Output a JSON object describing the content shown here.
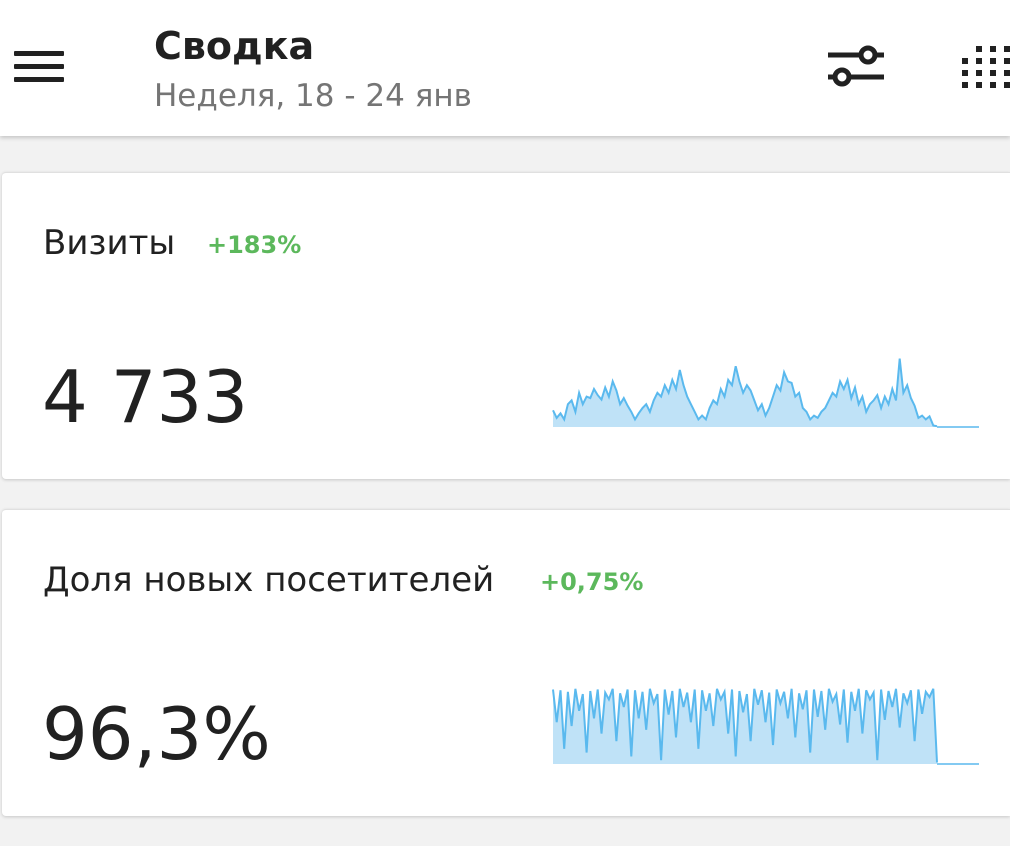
{
  "header": {
    "title": "Сводка",
    "subtitle": "Неделя, 18 - 24 янв",
    "menu_icon": "hamburger-menu-icon",
    "filter_icon": "sliders-icon",
    "grid_icon": "dots-grid-icon"
  },
  "colors": {
    "positive": "#5cb85c",
    "spark_line": "#5ab9ee",
    "spark_fill": "#bfe2f7",
    "text": "#212121",
    "muted": "#757575"
  },
  "cards": [
    {
      "label": "Визиты",
      "delta": "+183%",
      "value": "4 733",
      "chart_data": {
        "type": "area",
        "ylim": [
          0,
          1
        ],
        "values": [
          0.22,
          0.12,
          0.18,
          0.1,
          0.3,
          0.35,
          0.2,
          0.45,
          0.3,
          0.4,
          0.38,
          0.5,
          0.42,
          0.36,
          0.52,
          0.4,
          0.6,
          0.48,
          0.3,
          0.38,
          0.28,
          0.2,
          0.1,
          0.18,
          0.25,
          0.3,
          0.2,
          0.35,
          0.45,
          0.4,
          0.55,
          0.45,
          0.62,
          0.5,
          0.75,
          0.55,
          0.4,
          0.3,
          0.2,
          0.1,
          0.15,
          0.1,
          0.25,
          0.35,
          0.3,
          0.5,
          0.4,
          0.62,
          0.55,
          0.8,
          0.6,
          0.45,
          0.55,
          0.48,
          0.35,
          0.22,
          0.3,
          0.15,
          0.25,
          0.4,
          0.55,
          0.48,
          0.72,
          0.6,
          0.58,
          0.4,
          0.45,
          0.25,
          0.2,
          0.1,
          0.15,
          0.12,
          0.2,
          0.25,
          0.35,
          0.45,
          0.4,
          0.6,
          0.5,
          0.62,
          0.38,
          0.52,
          0.3,
          0.4,
          0.2,
          0.3,
          0.35,
          0.42,
          0.25,
          0.4,
          0.3,
          0.5,
          0.35,
          0.9,
          0.45,
          0.55,
          0.38,
          0.28,
          0.12,
          0.15,
          0.1,
          0.14,
          0.02,
          0.01
        ]
      }
    },
    {
      "label": "Доля новых посетителей",
      "delta": "+0,75%",
      "value": "96,3%",
      "chart_data": {
        "type": "area",
        "ylim": [
          0,
          1
        ],
        "values": [
          0.98,
          0.55,
          0.97,
          0.2,
          0.95,
          0.5,
          0.99,
          0.7,
          0.92,
          0.15,
          0.96,
          0.6,
          0.98,
          0.4,
          0.94,
          0.85,
          0.99,
          0.3,
          0.93,
          0.75,
          0.98,
          0.1,
          0.97,
          0.6,
          0.95,
          0.45,
          0.99,
          0.8,
          0.92,
          0.05,
          0.98,
          0.65,
          0.96,
          0.35,
          0.99,
          0.75,
          0.94,
          0.55,
          0.98,
          0.2,
          0.97,
          0.7,
          0.93,
          0.5,
          0.99,
          0.85,
          0.95,
          0.4,
          0.98,
          0.1,
          0.96,
          0.68,
          0.92,
          0.3,
          0.99,
          0.78,
          0.97,
          0.55,
          0.94,
          0.25,
          0.98,
          0.8,
          0.95,
          0.6,
          0.99,
          0.35,
          0.93,
          0.72,
          0.97,
          0.15,
          0.98,
          0.62,
          0.96,
          0.45,
          0.99,
          0.82,
          0.92,
          0.52,
          0.98,
          0.28,
          0.95,
          0.7,
          0.99,
          0.4,
          0.97,
          0.85,
          0.94,
          0.05,
          0.98,
          0.58,
          0.96,
          0.75,
          0.99,
          0.48,
          0.93,
          0.8,
          0.97,
          0.3,
          0.98,
          0.66,
          0.95,
          0.88,
          0.99,
          0.02
        ]
      }
    }
  ]
}
